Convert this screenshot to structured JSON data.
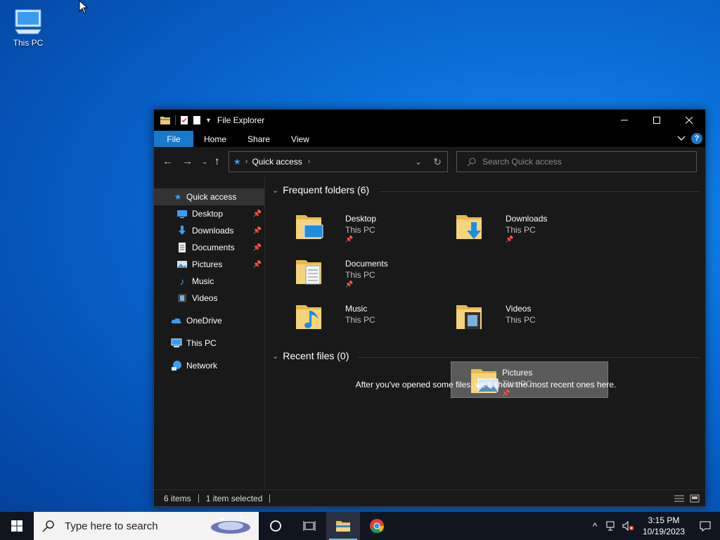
{
  "desktop": {
    "icons": [
      {
        "label": "This PC",
        "icon": "computer-icon"
      }
    ]
  },
  "window": {
    "title": "File Explorer",
    "ribbon": {
      "file": "File",
      "home": "Home",
      "share": "Share",
      "view": "View"
    },
    "address": {
      "crumb": "Quick access"
    },
    "search": {
      "placeholder": "Search Quick access"
    },
    "sidebar": {
      "quick_access": "Quick access",
      "items": [
        {
          "label": "Desktop",
          "pinned": true
        },
        {
          "label": "Downloads",
          "pinned": true
        },
        {
          "label": "Documents",
          "pinned": true
        },
        {
          "label": "Pictures",
          "pinned": true
        },
        {
          "label": "Music",
          "pinned": false
        },
        {
          "label": "Videos",
          "pinned": false
        }
      ],
      "onedrive": "OneDrive",
      "thispc": "This PC",
      "network": "Network"
    },
    "content": {
      "frequent_header": "Frequent folders (6)",
      "recent_header": "Recent files (0)",
      "empty_message": "After you've opened some files, we'll show the most recent ones here.",
      "folders": [
        {
          "name": "Desktop",
          "location": "This PC",
          "pinned": true
        },
        {
          "name": "Downloads",
          "location": "This PC",
          "pinned": true
        },
        {
          "name": "Documents",
          "location": "This PC",
          "pinned": true
        },
        {
          "name": "Pictures",
          "location": "This PC",
          "pinned": true,
          "selected": true
        },
        {
          "name": "Music",
          "location": "This PC",
          "pinned": false
        },
        {
          "name": "Videos",
          "location": "This PC",
          "pinned": false
        }
      ]
    },
    "status": {
      "items": "6 items",
      "selected": "1 item selected"
    }
  },
  "taskbar": {
    "search_placeholder": "Type here to search",
    "clock_time": "3:15 PM",
    "clock_date": "10/19/2023"
  },
  "colors": {
    "accent": "#1979ca",
    "folder": "#f3c85e",
    "taskbar": "#101520"
  }
}
